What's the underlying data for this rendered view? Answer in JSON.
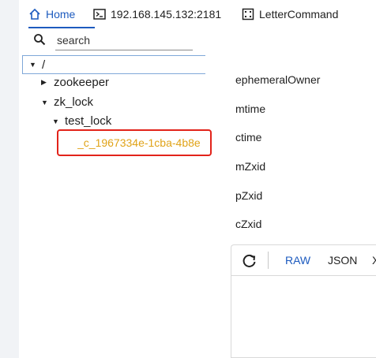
{
  "tabs": {
    "home": {
      "label": "Home",
      "icon": "home-icon"
    },
    "server": {
      "label": "192.168.145.132:2181",
      "icon": "terminal-icon"
    },
    "command": {
      "label": "LetterCommand",
      "icon": "command-icon"
    }
  },
  "search": {
    "placeholder": "search",
    "value": ""
  },
  "tree": {
    "root": "/",
    "nodes": [
      {
        "label": "zookeeper",
        "expanded": false
      },
      {
        "label": "zk_lock",
        "expanded": true
      },
      {
        "label": "test_lock",
        "expanded": true
      },
      {
        "label": "_c_1967334e-1cba-4b8e",
        "selected": true
      }
    ]
  },
  "fields": [
    "ephemeralOwner",
    "mtime",
    "ctime",
    "mZxid",
    "pZxid",
    "cZxid"
  ],
  "editor": {
    "raw_label": "RAW",
    "json_label": "JSON",
    "x_label": "X"
  },
  "colors": {
    "accent": "#1d5bbf",
    "selected_node_text": "#e0a318",
    "highlight_box": "#e2231a"
  }
}
